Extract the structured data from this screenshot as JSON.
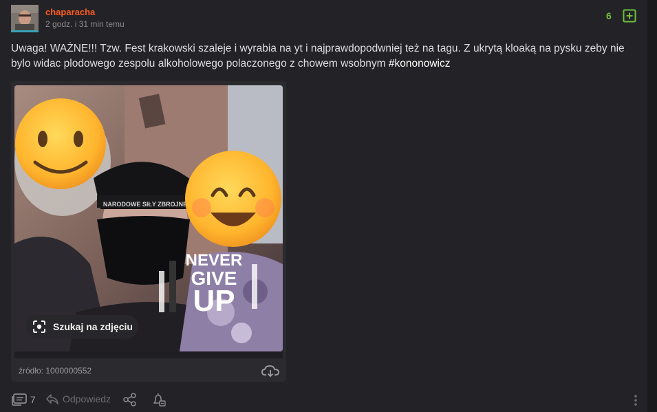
{
  "post": {
    "author": "chaparacha",
    "time": "2 godz. i 31 min temu",
    "votes": "6",
    "content_text": "Uwaga! WAŻNE!!! Tzw. Fest krakowski szaleje i wyrabia na yt i najprawdopodwniej też na tagu. Z ukrytą kloaką na pysku zeby nie bylo widac plodowego zespolu alkoholowego polaczonego z chowem wsobnym ",
    "hashtag": "#kononowicz"
  },
  "media": {
    "lens_label": "Szukaj na zdjęciu",
    "image_text_line1": "NEVER",
    "image_text_line2": "GIVE",
    "image_text_line3": "UP",
    "beanie_text": "NARODOWE SIŁY ZBROJNE",
    "source": "źródło: 1000000552"
  },
  "actions": {
    "comments_count": "7",
    "reply_label": "Odpowiedz"
  },
  "colors": {
    "author": "#ff5a1f",
    "vote": "#6fbf3b",
    "background": "#232327"
  },
  "icons": [
    "plus-square-icon",
    "lens-icon",
    "cloud-download-icon",
    "comments-icon",
    "reply-icon",
    "share-icon",
    "bell-icon",
    "more-vertical-icon"
  ]
}
